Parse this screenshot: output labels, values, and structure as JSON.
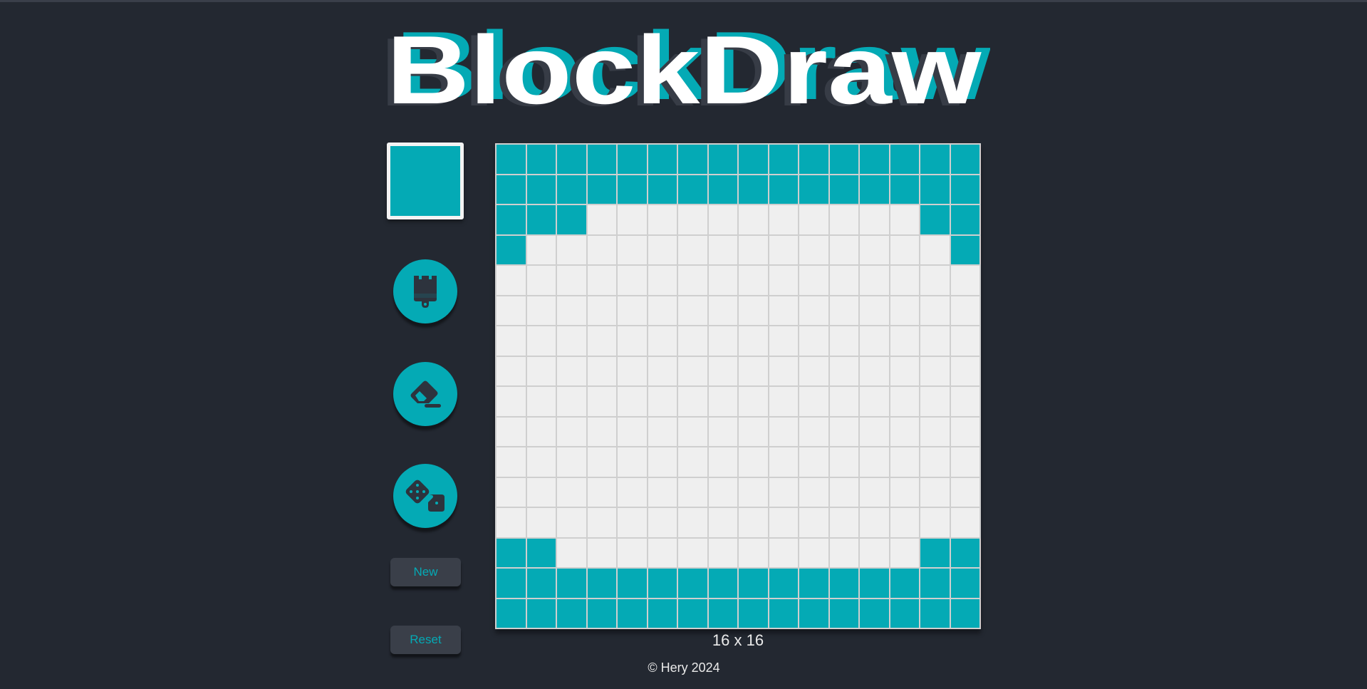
{
  "app": {
    "title": "BlockDraw"
  },
  "colors": {
    "background": "#232831",
    "accent": "#04aab5",
    "empty_cell": "#efefef",
    "cell_border": "#cfcfcf",
    "button_bg": "#3a3f49",
    "icon_dark": "#2d333d",
    "title_shadow": "#373c46",
    "text_light": "#eaeaea"
  },
  "toolbar": {
    "current_color": "#04aab5",
    "brush": {
      "icon": "paintbrush-icon"
    },
    "eraser": {
      "icon": "eraser-icon"
    },
    "random": {
      "icon": "dice-icon"
    },
    "new_label": "New",
    "reset_label": "Reset"
  },
  "grid": {
    "size_label": "16 x 16",
    "columns": 16,
    "rows": 16,
    "cells": [
      "1111111111111111",
      "1111111111111111",
      "1110000000000011",
      "1000000000000001",
      "0000000000000000",
      "0000000000000000",
      "0000000000000000",
      "0000000000000000",
      "0000000000000000",
      "0000000000000000",
      "0000000000000000",
      "0000000000000000",
      "0000000000000000",
      "1100000000000011",
      "1111111111111111",
      "1111111111111111"
    ]
  },
  "footer": {
    "copyright": "© Hery 2024"
  }
}
